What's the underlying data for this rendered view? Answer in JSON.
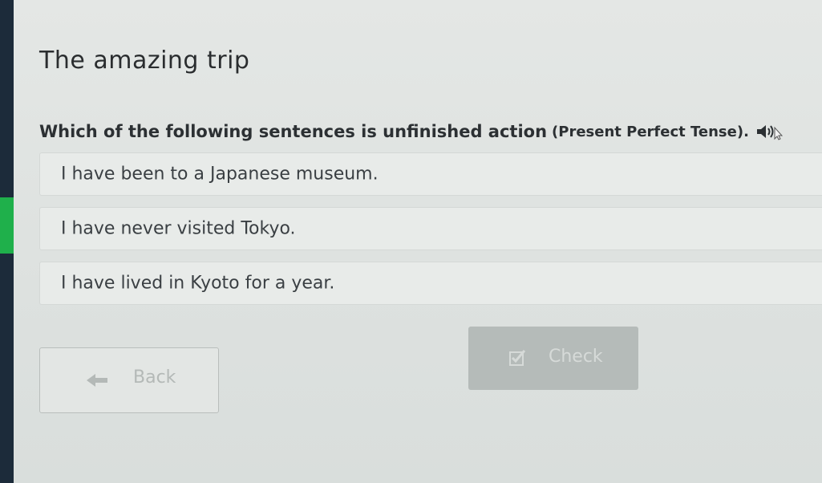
{
  "page": {
    "title": "The amazing trip"
  },
  "question": {
    "text": "Which of the following sentences is unfinished action",
    "hint": "(Present Perfect Tense).",
    "audio_icon": "speaker-icon"
  },
  "options": [
    {
      "label": "I have been to a Japanese museum."
    },
    {
      "label": "I have never visited Tokyo."
    },
    {
      "label": "I have lived in Kyoto for a year."
    }
  ],
  "navigation": {
    "back_label": "Back",
    "back_icon": "arrow-left-icon",
    "check_label": "Check",
    "check_icon": "checkbox-icon"
  },
  "colors": {
    "sidebar": "#1c2b3a",
    "accent_green": "#1fb04b",
    "check_button_bg": "#b5bbb9"
  }
}
